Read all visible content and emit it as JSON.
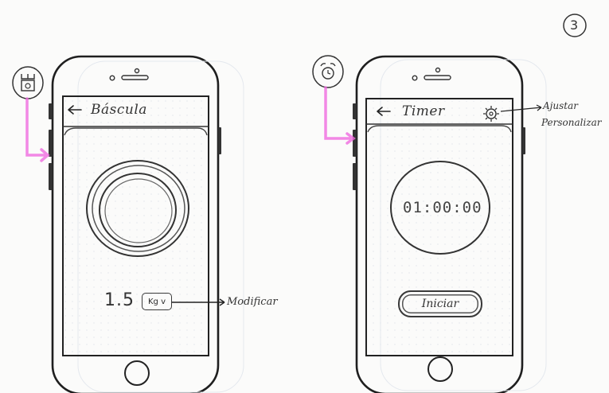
{
  "page": {
    "number": "3"
  },
  "screens": [
    {
      "id": "scale",
      "title": "Báscula",
      "back_icon": "arrow-left-icon",
      "side_icon": "scale-icon",
      "weight": {
        "value": "1.5",
        "unit": "Kg v"
      },
      "annotation": "Modificar"
    },
    {
      "id": "timer",
      "title": "Timer",
      "back_icon": "arrow-left-icon",
      "settings_icon": "gear-icon",
      "side_icon": "alarm-clock-icon",
      "time": "01:00:00",
      "start_label": "Iniciar",
      "annotation": [
        "Ajustar",
        "Personalizar"
      ]
    }
  ],
  "colors": {
    "pencil": "#2b2b2b",
    "highlighter": "#f06be0",
    "grid": "#e4e8ee"
  }
}
